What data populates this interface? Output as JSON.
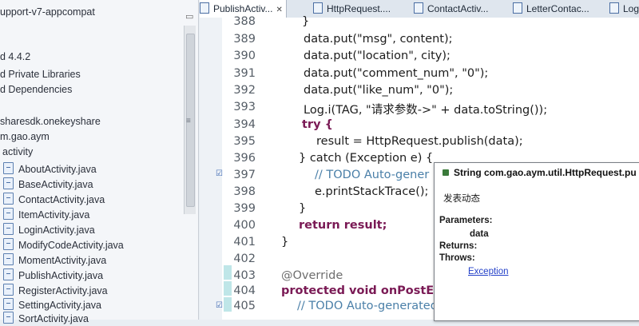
{
  "explorer": {
    "rows": [
      {
        "label": "upport-v7-appcompat"
      },
      {
        "label": "d 4.4.2"
      },
      {
        "label": "d Private Libraries"
      },
      {
        "label": "d Dependencies"
      },
      {
        "label": "sharesdk.onekeyshare"
      },
      {
        "label": "m.gao.aym"
      },
      {
        "label": "activity"
      },
      {
        "label": "AboutActivity.java"
      },
      {
        "label": "BaseActivity.java"
      },
      {
        "label": "ContactActivity.java"
      },
      {
        "label": "ItemActivity.java"
      },
      {
        "label": "LoginActivity.java"
      },
      {
        "label": "ModifyCodeActivity.java"
      },
      {
        "label": "MomentActivity.java"
      },
      {
        "label": "PublishActivity.java"
      },
      {
        "label": "RegisterActivity.java"
      },
      {
        "label": "SettingActivity.java"
      },
      {
        "label": "SortActivity.java"
      }
    ]
  },
  "tabs": [
    {
      "label": "PublishActiv...",
      "close": "✕"
    },
    {
      "label": "HttpRequest...."
    },
    {
      "label": "ContactActiv..."
    },
    {
      "label": "LetterContac..."
    },
    {
      "label": "Logi"
    }
  ],
  "editor": {
    "lines": [
      {
        "n": "388",
        "code": "}"
      },
      {
        "n": "389",
        "code": "data.put(\"msg\", content);"
      },
      {
        "n": "390",
        "code": "data.put(\"location\", city);"
      },
      {
        "n": "391",
        "code": "data.put(\"comment_num\", \"0\");"
      },
      {
        "n": "392",
        "code": "data.put(\"like_num\", \"0\");"
      },
      {
        "n": "393",
        "code": "Log.i(TAG, \"请求参数->\" + data.toString());"
      },
      {
        "n": "394",
        "code": "try {"
      },
      {
        "n": "395",
        "code": "result = HttpRequest.publish(data);"
      },
      {
        "n": "396",
        "code": "} catch (Exception e) {"
      },
      {
        "n": "397",
        "code": "// TODO Auto-gener"
      },
      {
        "n": "398",
        "code": "e.printStackTrace();"
      },
      {
        "n": "399",
        "code": "}"
      },
      {
        "n": "400",
        "code": "return result;"
      },
      {
        "n": "401",
        "code": "}"
      },
      {
        "n": "402",
        "code": ""
      },
      {
        "n": "403",
        "code": "@Override"
      },
      {
        "n": "404",
        "code": "protected void onPostExe"
      },
      {
        "n": "405",
        "code": "// TODO Auto-generated method stub"
      }
    ]
  },
  "popup": {
    "signature": "String com.gao.aym.util.HttpRequest.pu",
    "description": "发表动态",
    "parameters_label": "Parameters:",
    "param_name": "data",
    "returns_label": "Returns:",
    "throws_label": "Throws:",
    "exception_link": "Exception"
  }
}
